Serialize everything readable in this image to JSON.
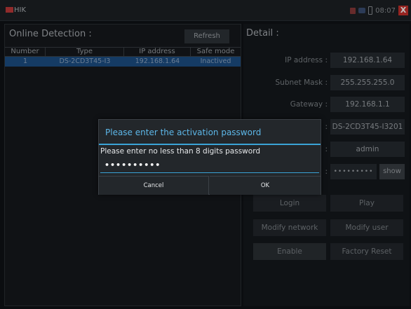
{
  "topbar": {
    "brand": "HIK",
    "time": "08:07",
    "close_label": "X"
  },
  "left": {
    "title": "Online Detection :",
    "refresh_label": "Refresh",
    "columns": [
      "Number",
      "Type",
      "IP address",
      "Safe mode"
    ],
    "rows": [
      [
        "1",
        "DS-2CD3T45-I3",
        "192.168.1.64",
        "Inactived"
      ]
    ]
  },
  "detail": {
    "title": "Detail :",
    "ip_label": "IP address :",
    "ip_value": "192.168.1.64",
    "mask_label": "Subnet Mask :",
    "mask_value": "255.255.255.0",
    "gateway_label": "Gateway :",
    "gateway_value": "192.168.1.1",
    "model_label": ":",
    "model_value": "DS-2CD3T45-I3201",
    "user_label": ":",
    "user_value": "admin",
    "password_label": ":",
    "password_value": "•••••••••",
    "show_label": "show",
    "buttons": {
      "login": "Login",
      "play": "Play",
      "modify_network": "Modify network",
      "modify_user": "Modify user",
      "enable": "Enable",
      "factory_reset": "Factory Reset"
    }
  },
  "dialog": {
    "title": "Please enter the activation password",
    "message": "Please enter no less than 8 digits password",
    "password_value": "••••••••••",
    "cancel_label": "Cancel",
    "ok_label": "OK"
  }
}
